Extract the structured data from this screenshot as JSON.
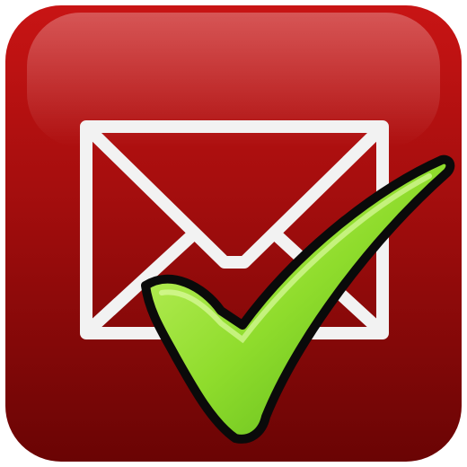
{
  "icon": {
    "name": "mail-checked-icon",
    "colors": {
      "tile_light": "#c81414",
      "tile_mid": "#a10d0d",
      "tile_dark": "#6a0404",
      "envelope_outline": "#f2f2f2",
      "check_light": "#c9f56a",
      "check_mid": "#8fdc2c",
      "check_dark": "#4fae16",
      "check_outline": "#0a0a0a"
    }
  }
}
